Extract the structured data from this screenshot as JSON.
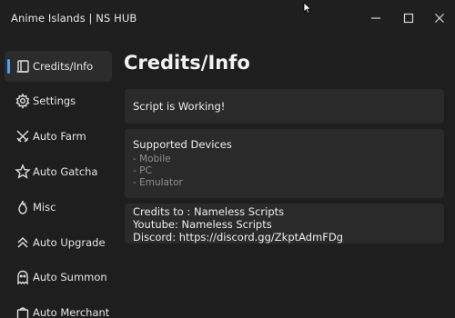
{
  "window": {
    "title": "Anime Islands | NS HUB",
    "controls": {
      "minimize": "minimize",
      "maximize": "maximize",
      "close": "close"
    }
  },
  "sidebar": {
    "items": [
      {
        "label": "Credits/Info",
        "icon": "book-icon",
        "active": true
      },
      {
        "label": "Settings",
        "icon": "gear-icon",
        "active": false
      },
      {
        "label": "Auto Farm",
        "icon": "crossed-swords-icon",
        "active": false
      },
      {
        "label": "Auto Gatcha",
        "icon": "star-icon",
        "active": false
      },
      {
        "label": "Misc",
        "icon": "flame-icon",
        "active": false
      },
      {
        "label": "Auto Upgrade",
        "icon": "double-chevron-up-icon",
        "active": false
      },
      {
        "label": "Auto Summon",
        "icon": "ghost-icon",
        "active": false
      },
      {
        "label": "Auto Merchant",
        "icon": "bag-icon",
        "active": false
      }
    ]
  },
  "main": {
    "title": "Credits/Info",
    "status": "Script is Working!",
    "devices": {
      "heading": "Supported Devices",
      "list": [
        "- Mobile",
        "- PC",
        "- Emulator"
      ]
    },
    "credits": {
      "line1": "Credits to : Nameless Scripts",
      "line2": "Youtube: Nameless Scripts",
      "line3": "Discord: https://discord.gg/ZkptAdmFDg"
    }
  },
  "colors": {
    "background": "#1e1e1e",
    "card": "#2a2a2a",
    "active_item": "#2c2c2c",
    "accent": "#4ea1ff"
  }
}
